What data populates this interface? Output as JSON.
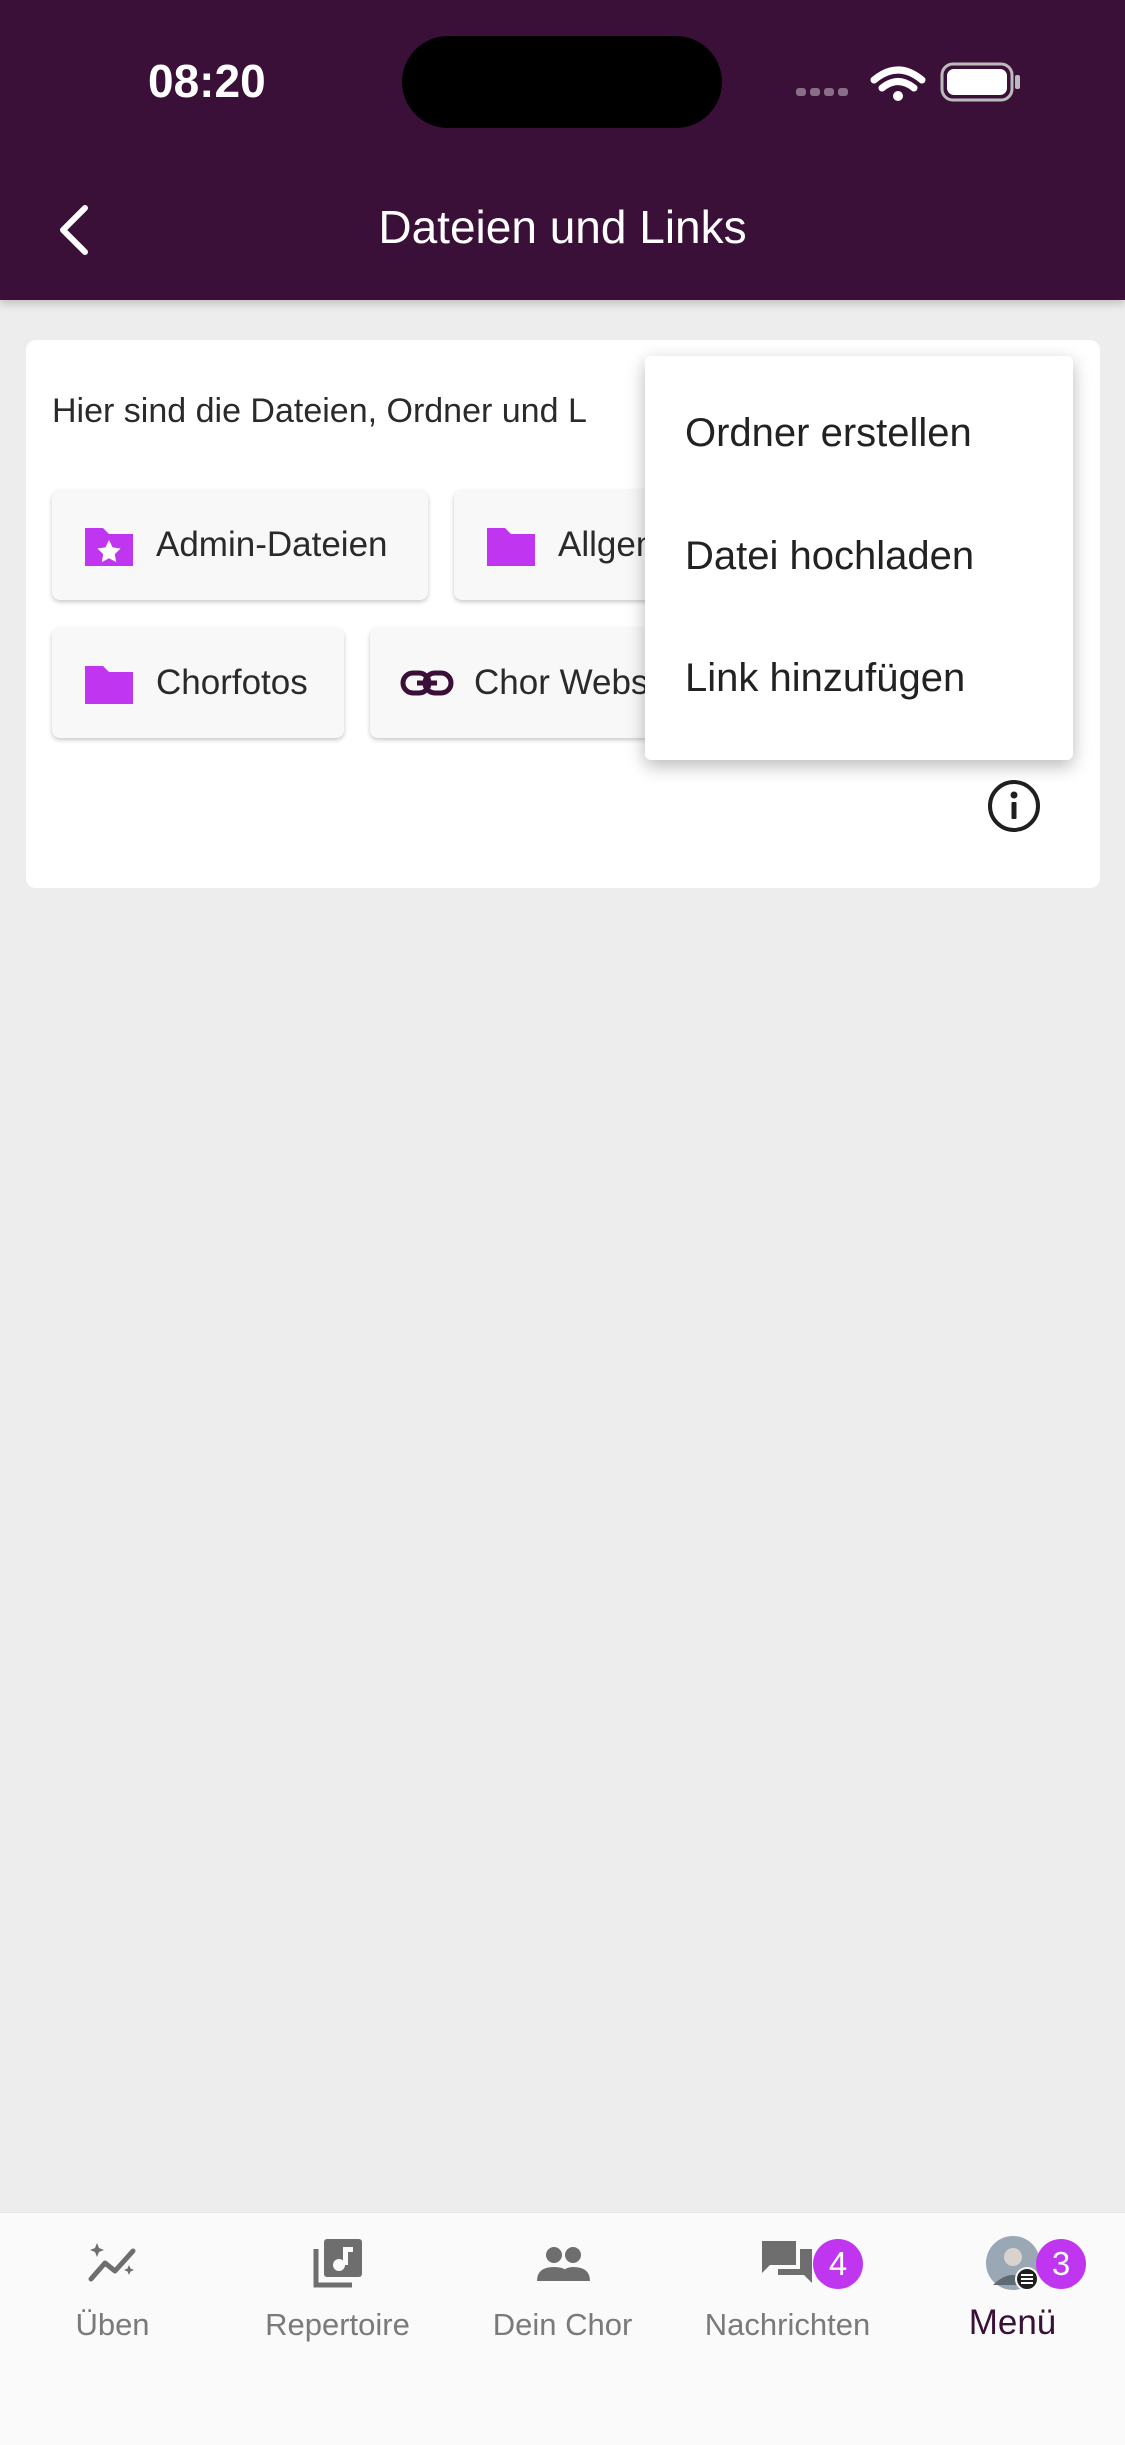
{
  "status_bar": {
    "time": "08:20"
  },
  "header": {
    "title": "Dateien und Links"
  },
  "card": {
    "intro": "Hier sind die Dateien, Ordner und L",
    "chips": [
      {
        "label": "Admin-Dateien",
        "icon": "folder-star-icon"
      },
      {
        "label": "Allgem",
        "icon": "folder-icon"
      },
      {
        "label": "Chorfotos",
        "icon": "folder-icon"
      },
      {
        "label": "Chor Websi",
        "icon": "link-icon"
      }
    ]
  },
  "menu": {
    "items": [
      {
        "label": "Ordner erstellen"
      },
      {
        "label": "Datei hochladen"
      },
      {
        "label": "Link hinzufügen"
      }
    ]
  },
  "bottom_nav": {
    "items": [
      {
        "label": "Üben",
        "icon": "trend-sparkle-icon"
      },
      {
        "label": "Repertoire",
        "icon": "music-library-icon"
      },
      {
        "label": "Dein Chor",
        "icon": "people-icon"
      },
      {
        "label": "Nachrichten",
        "icon": "chat-icon",
        "badge": "4"
      },
      {
        "label": "Menü",
        "icon": "avatar-icon",
        "badge": "3",
        "active": true
      }
    ]
  },
  "colors": {
    "header_bg": "#3b1038",
    "accent": "#c036f0",
    "background": "#ededed"
  }
}
